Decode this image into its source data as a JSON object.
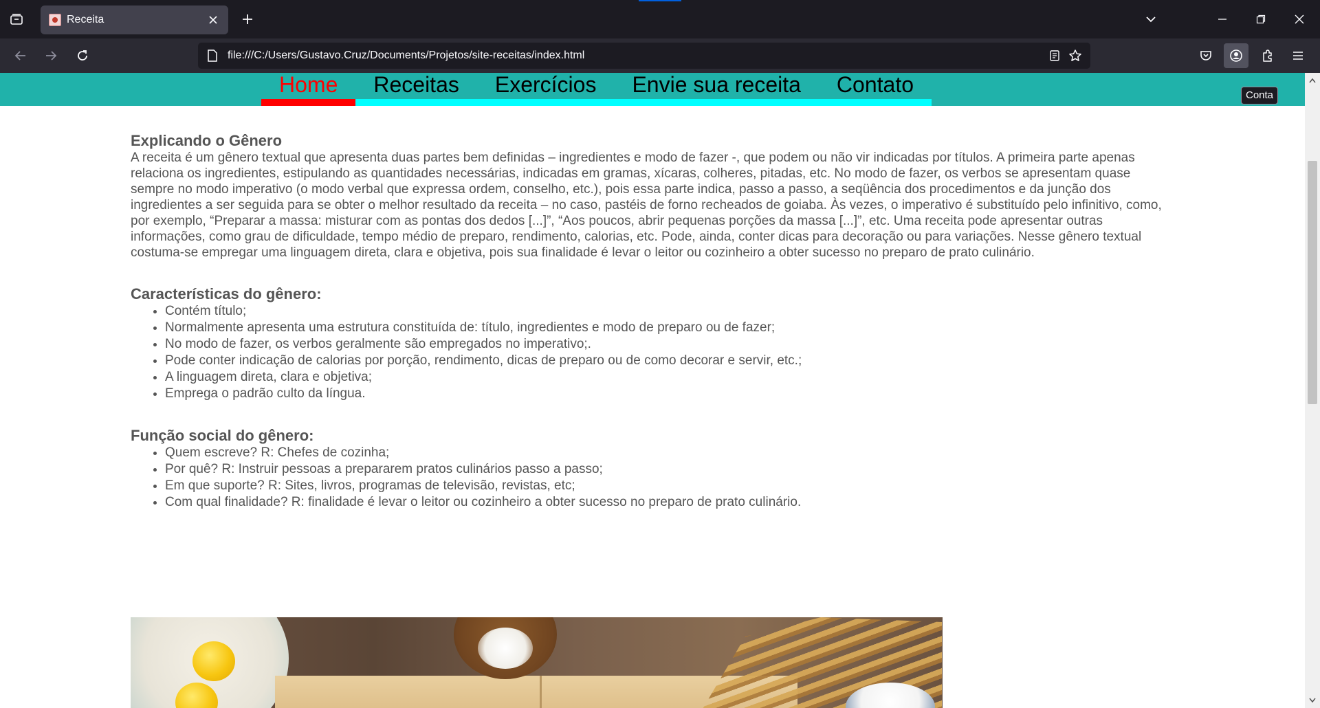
{
  "browser": {
    "tab_title": "Receita",
    "url": "file:///C:/Users/Gustavo.Cruz/Documents/Projetos/site-receitas/index.html",
    "tooltip": "Conta",
    "icons": [
      "tab-list-icon",
      "close-icon",
      "plus-icon",
      "chevron-down-icon",
      "minimize-icon",
      "restore-icon",
      "window-close-icon",
      "back-arrow-icon",
      "forward-arrow-icon",
      "reload-icon",
      "page-icon",
      "reader-view-icon",
      "star-icon",
      "pocket-icon",
      "account-icon",
      "extensions-icon",
      "menu-icon"
    ]
  },
  "site": {
    "nav": [
      {
        "label": "Home",
        "active": true
      },
      {
        "label": "Receitas",
        "active": false
      },
      {
        "label": "Exercícios",
        "active": false
      },
      {
        "label": "Envie sua receita",
        "active": false
      },
      {
        "label": "Contato",
        "active": false
      }
    ],
    "colors": {
      "header_bg": "#20b2aa",
      "nav_underline": "#00ffff",
      "active_color": "#ff0000",
      "text": "#555555"
    }
  },
  "content": {
    "genre": {
      "title": "Explicando o Gênero",
      "text": "A receita é um gênero textual que apresenta duas partes bem definidas – ingredientes e modo de fazer -, que podem ou não vir indicadas por títulos. A primeira parte apenas relaciona os ingredientes, estipulando as quantidades necessárias, indicadas em gramas, xícaras, colheres, pitadas, etc. No modo de fazer, os verbos se apresentam quase sempre no modo imperativo (o modo verbal que expressa ordem, conselho, etc.), pois essa parte indica, passo a passo, a seqüência dos procedimentos e da junção dos ingredientes a ser seguida para se obter o melhor resultado da receita – no caso, pastéis de forno recheados de goiaba. Às vezes, o imperativo é substituído pelo infinitivo, como, por exemplo, “Preparar a massa: misturar com as pontas dos dedos [...]”, “Aos poucos, abrir pequenas porções da massa [...]”, etc. Uma receita pode apresentar outras informações, como grau de dificuldade, tempo médio de preparo, rendimento, calorias, etc. Pode, ainda, conter dicas para decoração ou para variações. Nesse gênero textual costuma-se empregar uma linguagem direta, clara e objetiva, pois sua finalidade é levar o leitor ou cozinheiro a obter sucesso no preparo de prato culinário."
    },
    "characteristics": {
      "title": "Características do gênero:",
      "items": [
        "Contém título;",
        "Normalmente apresenta uma estrutura constituída de: título, ingredientes e modo de preparo ou de fazer;",
        "No modo de fazer, os verbos geralmente são empregados no imperativo;.",
        "Pode conter indicação de calorias por porção, rendimento, dicas de preparo ou de como decorar e servir, etc.;",
        "A linguagem direta, clara e objetiva;",
        "Emprega o padrão culto da língua."
      ]
    },
    "social": {
      "title": "Função social do gênero:",
      "items": [
        "Quem escreve? R: Chefes de cozinha;",
        "Por quê? R: Instruir pessoas a prepararem pratos culinários passo a passo;",
        "Em que suporte? R: Sites, livros, programas de televisão, revistas, etc;",
        "Com qual finalidade? R: finalidade é levar o leitor ou cozinheiro a obter sucesso no preparo de prato culinário."
      ]
    }
  }
}
